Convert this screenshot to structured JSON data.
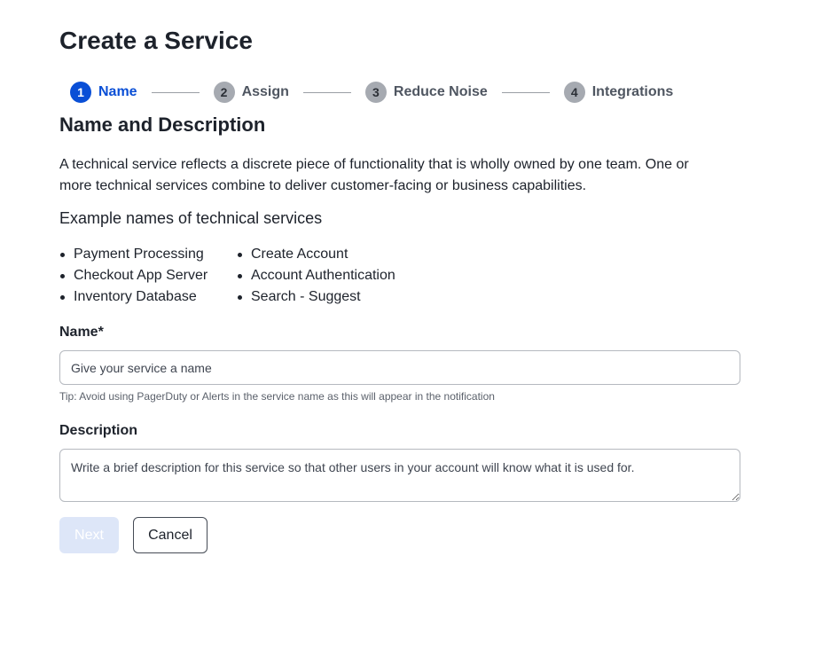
{
  "page": {
    "title": "Create a Service"
  },
  "stepper": {
    "steps": [
      {
        "number": "1",
        "label": "Name",
        "active": true
      },
      {
        "number": "2",
        "label": "Assign",
        "active": false
      },
      {
        "number": "3",
        "label": "Reduce Noise",
        "active": false
      },
      {
        "number": "4",
        "label": "Integrations",
        "active": false
      }
    ]
  },
  "section": {
    "title": "Name and Description",
    "intro": "A technical service reflects a discrete piece of functionality that is wholly owned by one team. One or more technical services combine to deliver customer-facing or business capabilities.",
    "examples_title": "Example names of technical services",
    "examples": [
      "Payment Processing",
      "Checkout App Server",
      "Inventory Database",
      "Create Account",
      "Account Authentication",
      "Search - Suggest"
    ]
  },
  "form": {
    "name": {
      "label": "Name*",
      "value": "",
      "placeholder": "Give your service a name",
      "tip": "Tip: Avoid using PagerDuty or Alerts in the service name as this will appear in the notification"
    },
    "description": {
      "label": "Description",
      "value": "",
      "placeholder": "Write a brief description for this service so that other users in your account will know what it is used for."
    },
    "next_label": "Next",
    "cancel_label": "Cancel"
  },
  "colors": {
    "accent": "#0a4fd6",
    "step_inactive": "#a6aab1",
    "next_disabled_bg": "#dde6f8"
  }
}
